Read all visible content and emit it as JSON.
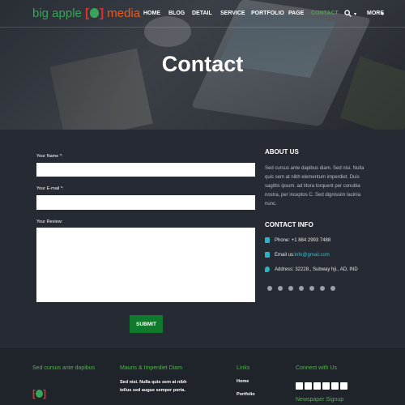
{
  "brand": {
    "part1": "big apple",
    "open": "[",
    "close": "]",
    "part2": "media"
  },
  "nav": {
    "items": [
      "HOME",
      "BLOG",
      "DETAIL",
      "SERVICE",
      "PORTFOLIO",
      "PAGE",
      "CONTACT"
    ],
    "active": "CONTACT",
    "more": "MORE"
  },
  "hero": {
    "title": "Contact"
  },
  "form": {
    "name_label": "Your Name *:",
    "email_label": "Your E-mail *:",
    "review_label": "Your Review:",
    "name_value": "",
    "email_value": "",
    "review_value": "",
    "submit_label": "SUBMIT"
  },
  "about": {
    "heading": "ABOUT US",
    "text": "Sed cursus ante dapibus diam. Sed nisi. Nulla quis sem at nibh elementum imperdiet. Duis sagittis ipsum. ad litora torquent per conubia nostra, per inceptos C. Sed dignissim lacinia nunc."
  },
  "contact_info": {
    "heading": "CONTACT INFO",
    "phone": "Phone: +1 884 2993 7488",
    "email_prefix": "Email us:",
    "email": "info@gmail.com",
    "address": "Address: 32228., Subway hji., AD, IND"
  },
  "social_icons": [
    "facebook-icon",
    "twitter-icon",
    "google-icon",
    "pinterest-icon",
    "dribbble-icon",
    "linkedin-icon",
    "youtube-icon"
  ],
  "footer": {
    "col1_heading": "Sed cursus ante dapibus",
    "col2_heading": "Mauris & Imperdiet Diam",
    "col2_text1": "Sed nisi. Nulla quis sem at nibh",
    "col2_text2": "tellus sed augue semper porta.",
    "col3_heading": "Links",
    "links": [
      "Home",
      "Portfolio"
    ],
    "col4_heading": "Connect with Us",
    "newsletter": "Newspaper Signup"
  },
  "colors": {
    "accent": "#49a547",
    "button": "#0f7a2b",
    "link": "#2ec1d4",
    "brand_red": "#e2322b"
  }
}
